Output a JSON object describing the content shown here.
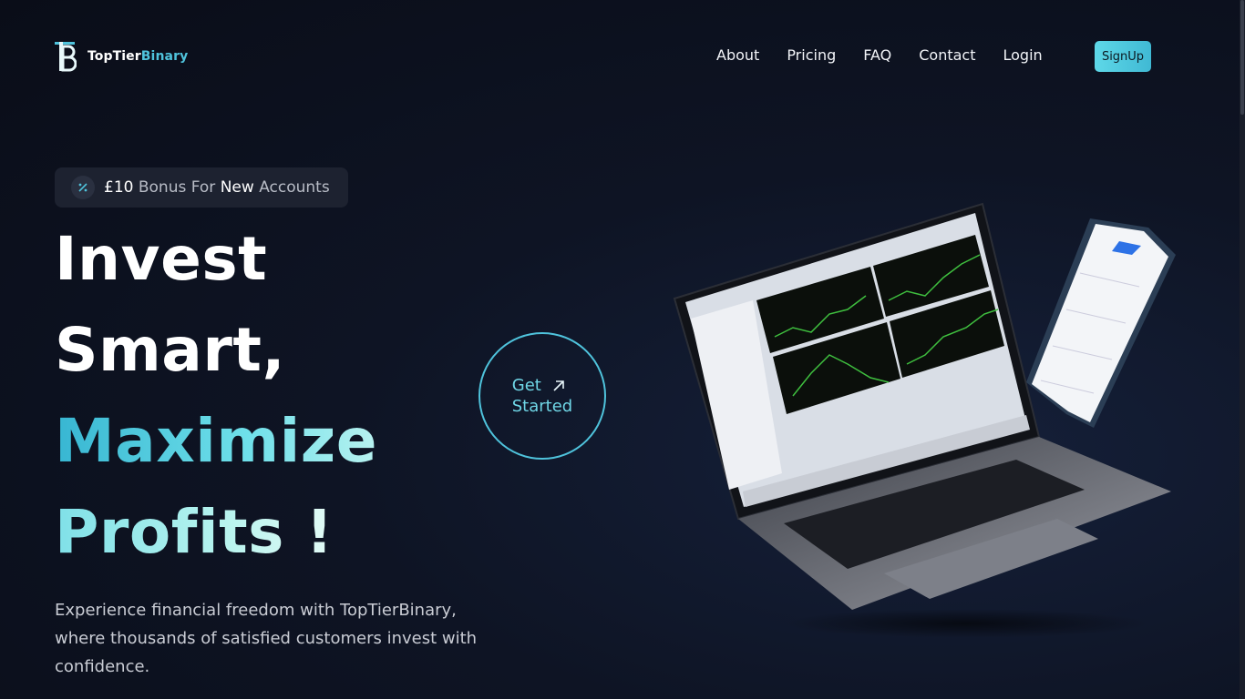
{
  "brand": {
    "name_part1": "TopTier",
    "name_part2": "Binary"
  },
  "nav": {
    "items": [
      "About",
      "Pricing",
      "FAQ",
      "Contact",
      "Login"
    ],
    "signup_label": "SignUp"
  },
  "promo": {
    "icon": "percent-icon",
    "amount": "£10",
    "word1": "Bonus For",
    "word2": "New",
    "word3": "Accounts"
  },
  "hero": {
    "line1": "Invest",
    "line2": "Smart,",
    "line3": "Maximize",
    "line4": "Profits !",
    "subtext": "Experience financial freedom with TopTierBinary, where thousands of satisfied customers invest with confidence."
  },
  "cta": {
    "line1": "Get",
    "line2": "Started",
    "icon": "arrow-up-right-icon"
  },
  "colors": {
    "accent": "#4fc3dc",
    "background": "#0c111e",
    "signup_bg": "#4fcbe0"
  }
}
